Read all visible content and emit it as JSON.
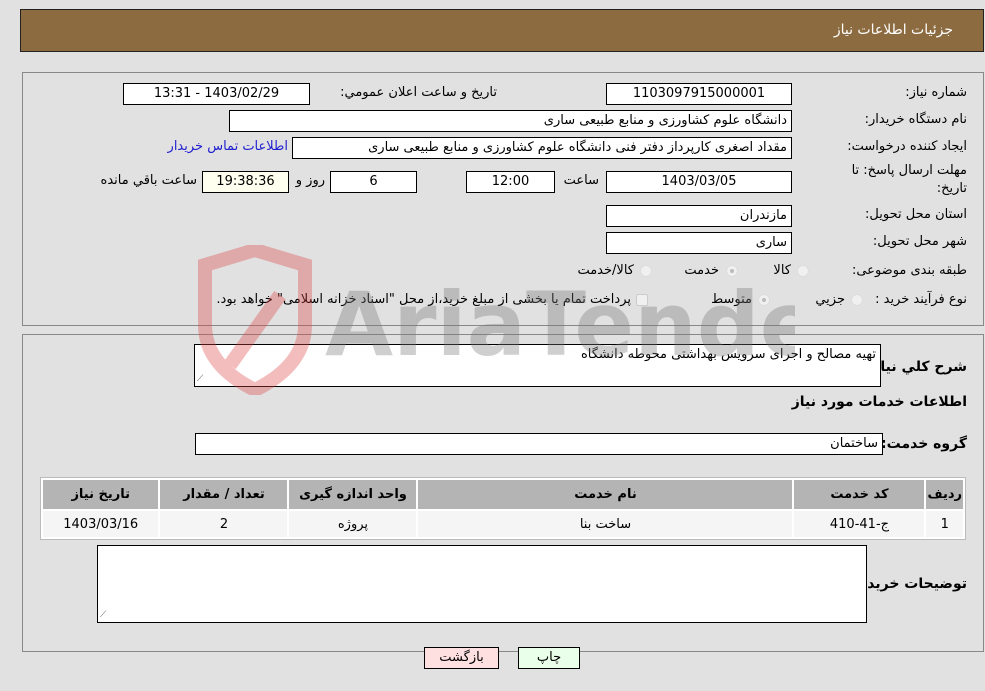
{
  "header": {
    "title": "جزئیات اطلاعات نیاز"
  },
  "fields": {
    "need_number": {
      "label": "شماره نیاز:",
      "value": "1103097915000001"
    },
    "announce_datetime": {
      "label": "تاریخ و ساعت اعلان عمومي:",
      "value": "1403/02/29 - 13:31"
    },
    "buyer_org": {
      "label": "نام دستگاه خریدار:",
      "value": "دانشگاه علوم کشاورزی و منابع طبیعی ساری"
    },
    "creator": {
      "label": "ایجاد کننده درخواست:",
      "value": "مقداد اصغری کارپرداز دفتر فنی دانشگاه علوم کشاورزی و منابع طبیعی ساری"
    },
    "buyer_contact_link": "اطلاعات تماس خریدار",
    "deadline": {
      "label_line1": "مهلت ارسال پاسخ: تا",
      "label_line2": "تاریخ:",
      "date": "1403/03/05",
      "time_label": "ساعت",
      "time": "12:00",
      "days": "6",
      "days_label": "روز و",
      "remaining": "19:38:36",
      "remaining_label": "ساعت باقي مانده"
    },
    "province": {
      "label": "استان محل تحویل:",
      "value": "مازندران"
    },
    "city": {
      "label": "شهر محل تحویل:",
      "value": "ساری"
    },
    "category": {
      "label": "طبقه بندی موضوعی:",
      "options": [
        "کالا",
        "خدمت",
        "کالا/خدمت"
      ],
      "selected": "خدمت"
    },
    "process": {
      "label": "نوع فرآیند خرید :",
      "options": [
        "جزیي",
        "متوسط"
      ],
      "selected": "متوسط",
      "treasury_note": "پرداخت تمام یا بخشی از مبلغ خرید،از محل \"اسناد خزانه اسلامی\" خواهد بود.",
      "treasury_checked": false
    }
  },
  "description": {
    "label": "شرح کلي نیاز:",
    "value": "تهیه مصالح و اجرای سرویس بهداشتی محوطه دانشگاه"
  },
  "services_section_title": "اطلاعات خدمات مورد نیاز",
  "service_group": {
    "label": "گروه خدمت:",
    "value": "ساختمان"
  },
  "table": {
    "headers": [
      "ردیف",
      "کد خدمت",
      "نام خدمت",
      "واحد اندازه گیری",
      "تعداد / مقدار",
      "تاریخ نیاز"
    ],
    "rows": [
      [
        "1",
        "ج-41-410",
        "ساخت بنا",
        "پروژه",
        "2",
        "1403/03/16"
      ]
    ]
  },
  "buyer_notes": {
    "label": "توضیحات خریدار:",
    "value": ""
  },
  "buttons": {
    "print": "چاپ",
    "back": "بازگشت"
  },
  "watermark": "AriaTender.neT",
  "colors": {
    "header_bg": "#8c6b40",
    "print_bg": "#eaffea",
    "back_bg": "#ffe0e0",
    "link": "#2020d0"
  }
}
